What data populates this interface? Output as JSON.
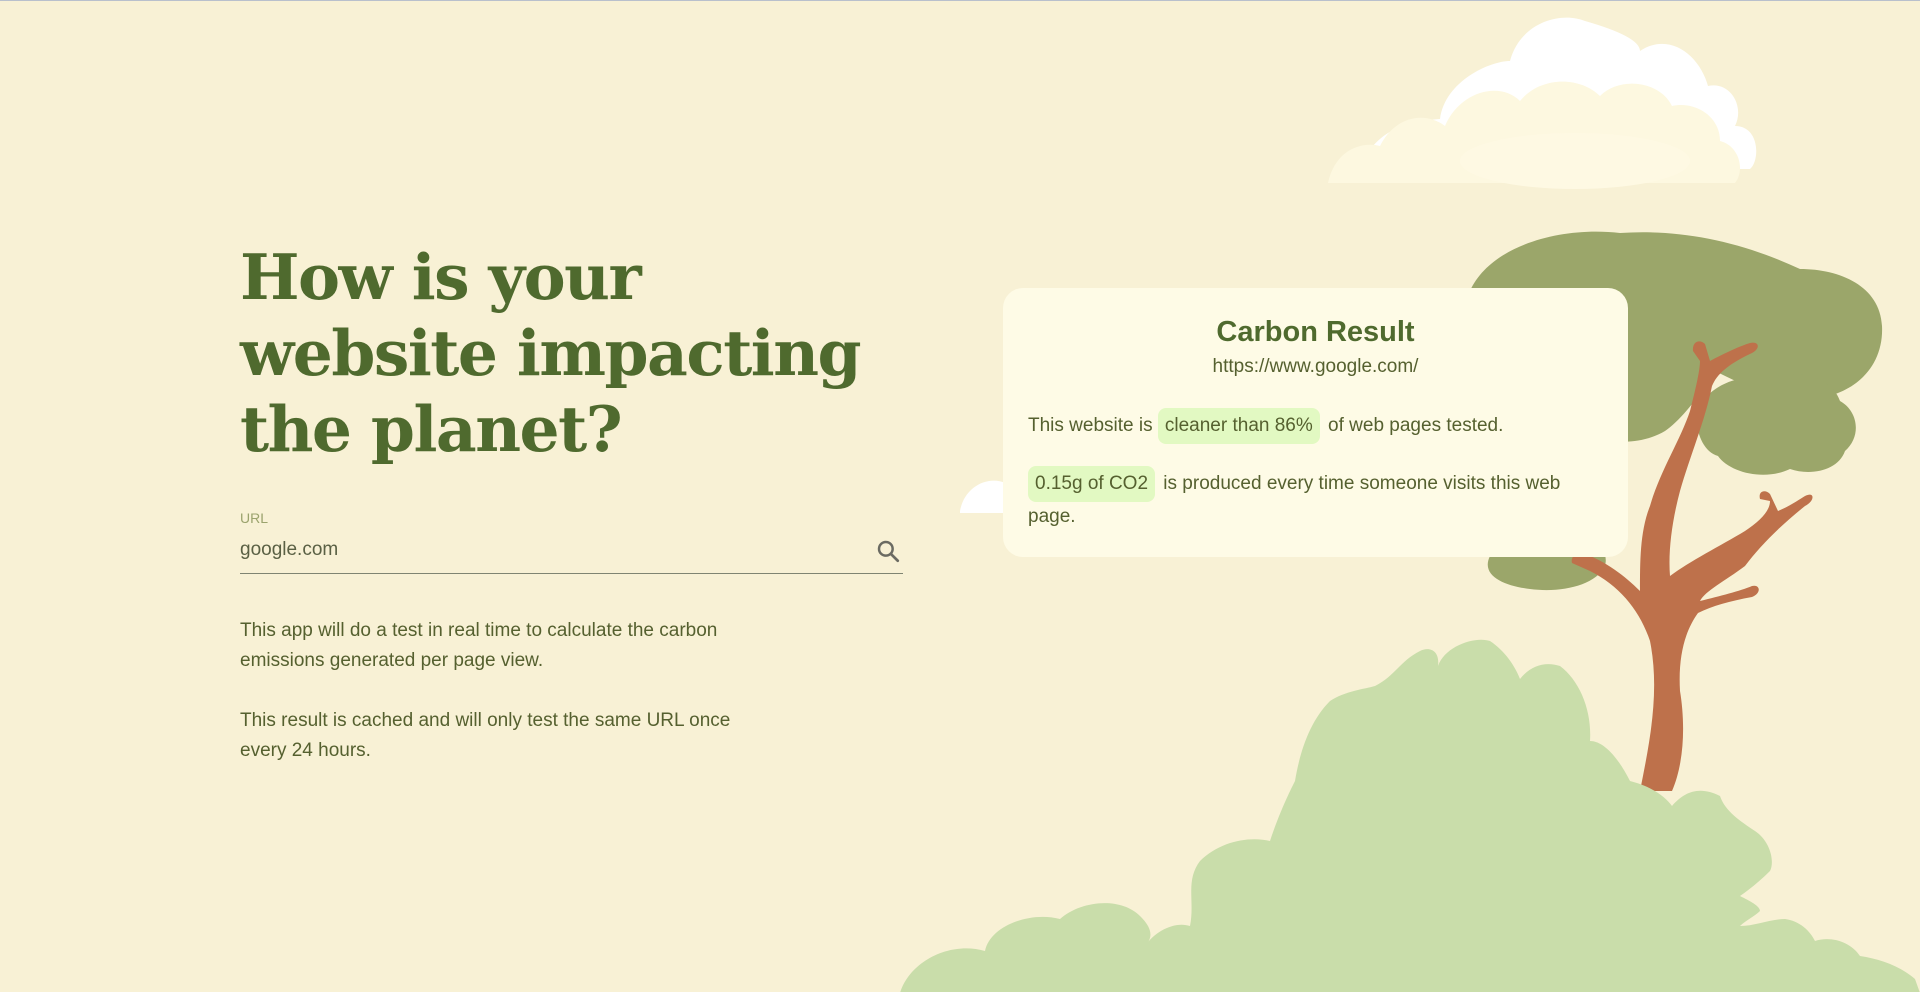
{
  "hero": {
    "heading": "How is your website impacting the planet?"
  },
  "search": {
    "label": "URL",
    "value": "google.com",
    "icon": "search-icon"
  },
  "info": {
    "paragraph_1": "This app will do a test in real time to calculate the carbon emissions generated per page view.",
    "paragraph_2": "This result is cached and will only test the same URL once every 24 hours."
  },
  "result": {
    "title": "Carbon Result",
    "url": "https://www.google.com/",
    "line1_prefix": "This website is ",
    "line1_highlight": "cleaner than 86%",
    "line1_suffix": " of web pages tested.",
    "line2_highlight": "0.15g of CO2",
    "line2_suffix": " is produced every time someone visits this web page."
  },
  "colors": {
    "background": "#f8f1d5",
    "heading": "#4f6a2e",
    "card": "#fefbe6",
    "highlight": "#e2f9c2",
    "tree_foliage": "#9ba66a",
    "bush": "#c9ddaa",
    "trunk": "#be714b"
  }
}
